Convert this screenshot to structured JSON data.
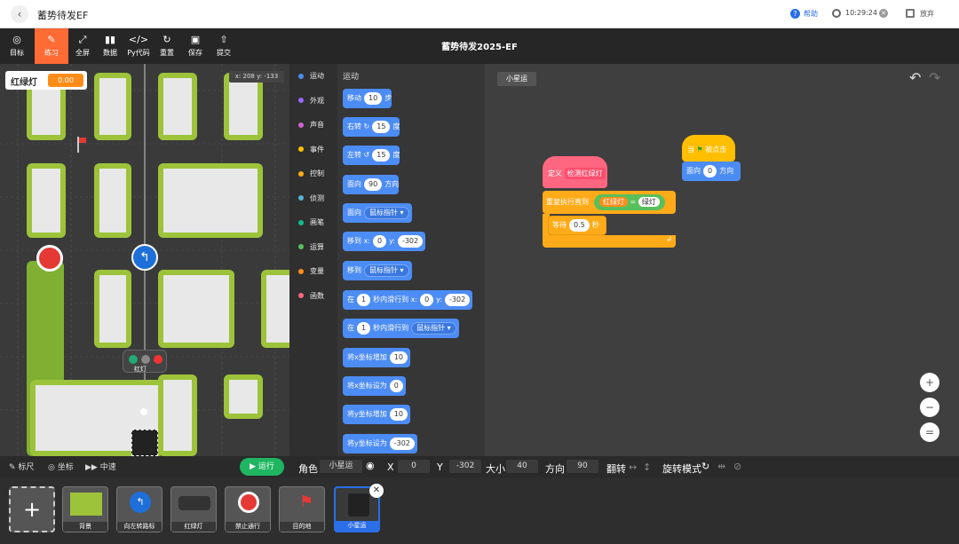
{
  "header": {
    "title": "蓄势待发EF",
    "help": "帮助",
    "time": "10:29:24",
    "quit": "放弃"
  },
  "toolbar": {
    "items": [
      "目标",
      "练习",
      "全屏",
      "数据",
      "Py代码",
      "重置",
      "保存",
      "提交"
    ],
    "center_title": "蓄势待发2025-EF"
  },
  "stage": {
    "variable_name": "红绿灯",
    "variable_value": "0.00",
    "coords": "x: 208  y: -133",
    "traffic_label": "红灯"
  },
  "categories": [
    {
      "label": "运动",
      "color": "#4c8cf5"
    },
    {
      "label": "外观",
      "color": "#9966ff"
    },
    {
      "label": "声音",
      "color": "#cf63cf"
    },
    {
      "label": "事件",
      "color": "#ffbf00"
    },
    {
      "label": "控制",
      "color": "#ffab19"
    },
    {
      "label": "侦测",
      "color": "#5cb1d6"
    },
    {
      "label": "画笔",
      "color": "#0fbd8c"
    },
    {
      "label": "运算",
      "color": "#59c059"
    },
    {
      "label": "变量",
      "color": "#ff8c1a"
    },
    {
      "label": "函数",
      "color": "#ff6680"
    }
  ],
  "palette": {
    "heading": "运动",
    "move": {
      "a": "移动",
      "v": "10",
      "b": "步"
    },
    "turn_right": {
      "a": "右转",
      "v": "15",
      "b": "度"
    },
    "turn_left": {
      "a": "左转",
      "v": "15",
      "b": "度"
    },
    "point_dir": {
      "a": "面向",
      "v": "90",
      "b": "方向"
    },
    "point_to": {
      "a": "面向",
      "v": "鼠标指针"
    },
    "goto_xy": {
      "a": "移到 x:",
      "x": "0",
      "b": "y:",
      "y": "-302"
    },
    "goto": {
      "a": "移到",
      "v": "鼠标指针"
    },
    "glide_xy": {
      "a": "在",
      "t": "1",
      "b": "秒内滑行到 x:",
      "x": "0",
      "c": "y:",
      "y": "-302"
    },
    "glide": {
      "a": "在",
      "t": "1",
      "b": "秒内滑行到",
      "v": "鼠标指针"
    },
    "change_x": {
      "a": "将x坐标增加",
      "v": "10"
    },
    "set_x": {
      "a": "将x坐标设为",
      "v": "0"
    },
    "change_y": {
      "a": "将y坐标增加",
      "v": "10"
    },
    "set_y": {
      "a": "将y坐标设为",
      "v": "-302"
    }
  },
  "script": {
    "sprite_tab": "小星运",
    "define": "定义",
    "define_name": "检测红绿灯",
    "repeat_until": "重复执行直到",
    "cond_var": "红绿灯",
    "eq": "=",
    "cond_val": "绿灯",
    "wait": "等待",
    "wait_val": "0.5",
    "wait_unit": "秒",
    "hat": "当",
    "hat_b": "被点击",
    "face": "面向",
    "face_val": "0",
    "face_unit": "方向"
  },
  "bottom": {
    "ruler": "标尺",
    "coord": "坐标",
    "speed": "中速",
    "run": "运行"
  },
  "props": {
    "role_label": "角色",
    "role": "小星运",
    "x_label": "X",
    "x": "0",
    "y_label": "Y",
    "y": "-302",
    "size_label": "大小",
    "size": "40",
    "dir_label": "方向",
    "dir": "90",
    "flip_label": "翻转",
    "rot_label": "旋转模式"
  },
  "sprites": [
    "背景",
    "向左转路标",
    "红绿灯",
    "禁止通行",
    "目的地",
    "小星运"
  ],
  "colors": {
    "accent": "#ff6b35",
    "run_green": "#1fb561",
    "block_blue": "#4c8cf5",
    "control": "#ffab19",
    "define_pink": "#ff6680",
    "operator": "#59c059"
  }
}
